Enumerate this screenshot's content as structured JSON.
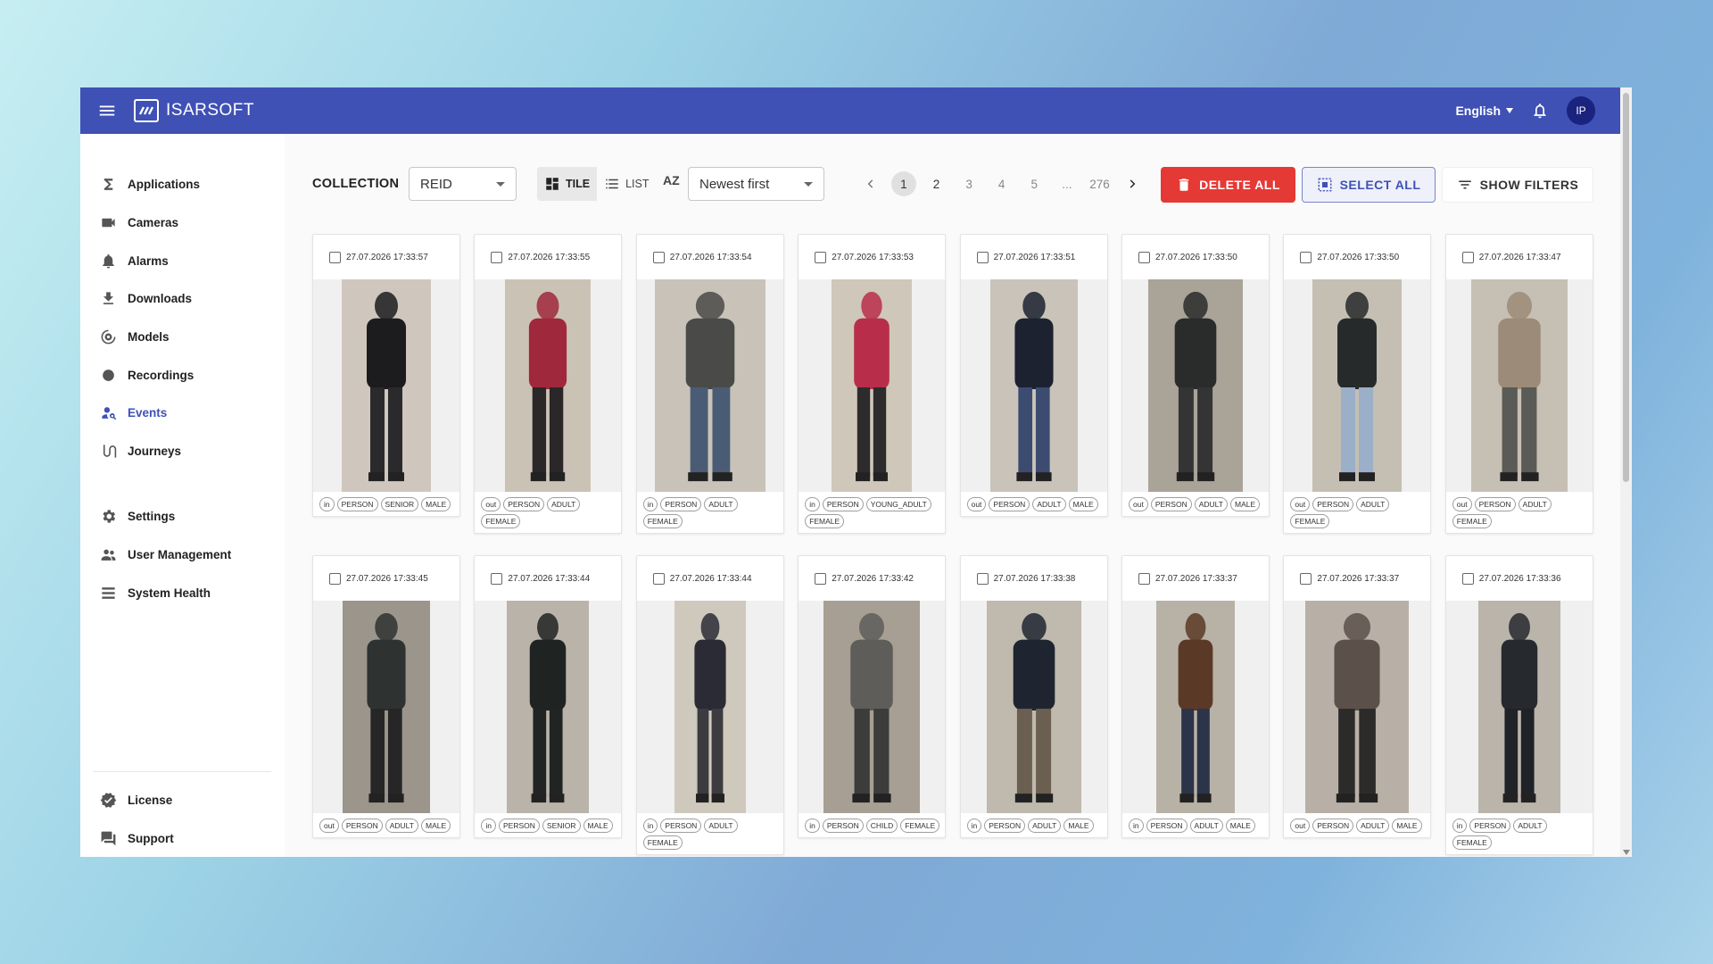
{
  "app": {
    "brand": "ISARSOFT",
    "language": "English",
    "user_initials": "IP"
  },
  "sidebar": {
    "items": [
      {
        "label": "Applications",
        "icon": "sigma-icon"
      },
      {
        "label": "Cameras",
        "icon": "camera-icon"
      },
      {
        "label": "Alarms",
        "icon": "bell-icon"
      },
      {
        "label": "Downloads",
        "icon": "download-icon"
      },
      {
        "label": "Models",
        "icon": "models-icon"
      },
      {
        "label": "Recordings",
        "icon": "record-icon"
      },
      {
        "label": "Events",
        "icon": "person-search-icon",
        "active": true
      },
      {
        "label": "Journeys",
        "icon": "journey-icon"
      },
      {
        "label": "Settings",
        "icon": "gear-icon"
      },
      {
        "label": "User Management",
        "icon": "users-icon"
      },
      {
        "label": "System Health",
        "icon": "list-icon"
      },
      {
        "label": "License",
        "icon": "verified-icon"
      },
      {
        "label": "Support",
        "icon": "chat-icon"
      }
    ]
  },
  "toolbar": {
    "collection_label": "COLLECTION",
    "collection_value": "REID",
    "view_tile": "TILE",
    "view_list": "LIST",
    "sort_icon_text": "AZ",
    "sort_value": "Newest first",
    "pages": [
      "1",
      "2",
      "3",
      "4",
      "5",
      "...",
      "276"
    ],
    "current_page": "1",
    "delete_all": "DELETE ALL",
    "select_all": "SELECT ALL",
    "show_filters": "SHOW FILTERS"
  },
  "events": [
    {
      "timestamp": "27.07.2026 17:33:57",
      "tags": [
        "in",
        "PERSON",
        "SENIOR",
        "MALE"
      ],
      "colors": [
        "#1c1c1e",
        "#2a2a2c",
        "#cfc7bd"
      ]
    },
    {
      "timestamp": "27.07.2026 17:33:55",
      "tags": [
        "out",
        "PERSON",
        "ADULT",
        "FEMALE"
      ],
      "colors": [
        "#a0283c",
        "#2b2628",
        "#cbc2b6"
      ]
    },
    {
      "timestamp": "27.07.2026 17:33:54",
      "tags": [
        "in",
        "PERSON",
        "ADULT",
        "FEMALE"
      ],
      "colors": [
        "#4a4a48",
        "#4a5c75",
        "#c8c2b8"
      ]
    },
    {
      "timestamp": "27.07.2026 17:33:53",
      "tags": [
        "in",
        "PERSON",
        "YOUNG_ADULT",
        "FEMALE"
      ],
      "colors": [
        "#b82e4a",
        "#2e2b2c",
        "#cfc7ba"
      ]
    },
    {
      "timestamp": "27.07.2026 17:33:51",
      "tags": [
        "out",
        "PERSON",
        "ADULT",
        "MALE"
      ],
      "colors": [
        "#1c2230",
        "#3b4c70",
        "#c9c3b9"
      ]
    },
    {
      "timestamp": "27.07.2026 17:33:50",
      "tags": [
        "out",
        "PERSON",
        "ADULT",
        "MALE"
      ],
      "colors": [
        "#2a2b2b",
        "#343434",
        "#a9a398"
      ]
    },
    {
      "timestamp": "27.07.2026 17:33:50",
      "tags": [
        "out",
        "PERSON",
        "ADULT",
        "FEMALE"
      ],
      "colors": [
        "#262a2a",
        "#9bb0c8",
        "#c5beb3"
      ]
    },
    {
      "timestamp": "27.07.2026 17:33:47",
      "tags": [
        "out",
        "PERSON",
        "ADULT",
        "FEMALE"
      ],
      "colors": [
        "#9b8b78",
        "#5a5a56",
        "#c6bfb3"
      ]
    },
    {
      "timestamp": "27.07.2026 17:33:45",
      "tags": [
        "out",
        "PERSON",
        "ADULT",
        "MALE"
      ],
      "colors": [
        "#2e3230",
        "#262626",
        "#9b958c"
      ]
    },
    {
      "timestamp": "27.07.2026 17:33:44",
      "tags": [
        "in",
        "PERSON",
        "SENIOR",
        "MALE"
      ],
      "colors": [
        "#1f2322",
        "#202524",
        "#b9b3a9"
      ]
    },
    {
      "timestamp": "27.07.2026 17:33:44",
      "tags": [
        "in",
        "PERSON",
        "ADULT",
        "FEMALE"
      ],
      "colors": [
        "#2a2b35",
        "#3b3b40",
        "#cfc8bd"
      ]
    },
    {
      "timestamp": "27.07.2026 17:33:42",
      "tags": [
        "in",
        "PERSON",
        "CHILD",
        "FEMALE"
      ],
      "colors": [
        "#5e5d5a",
        "#3c3c3a",
        "#a79f93"
      ]
    },
    {
      "timestamp": "27.07.2026 17:33:38",
      "tags": [
        "in",
        "PERSON",
        "ADULT",
        "MALE"
      ],
      "colors": [
        "#1f2530",
        "#6a5f50",
        "#bfb9ae"
      ]
    },
    {
      "timestamp": "27.07.2026 17:33:37",
      "tags": [
        "in",
        "PERSON",
        "ADULT",
        "MALE"
      ],
      "colors": [
        "#5a3a26",
        "#2b3448",
        "#b8b1a6"
      ]
    },
    {
      "timestamp": "27.07.2026 17:33:37",
      "tags": [
        "out",
        "PERSON",
        "ADULT",
        "MALE"
      ],
      "colors": [
        "#5b514a",
        "#2d2b2a",
        "#b8b0a6"
      ]
    },
    {
      "timestamp": "27.07.2026 17:33:36",
      "tags": [
        "in",
        "PERSON",
        "ADULT",
        "FEMALE"
      ],
      "colors": [
        "#26292e",
        "#1f2226",
        "#bab4ab"
      ]
    }
  ]
}
